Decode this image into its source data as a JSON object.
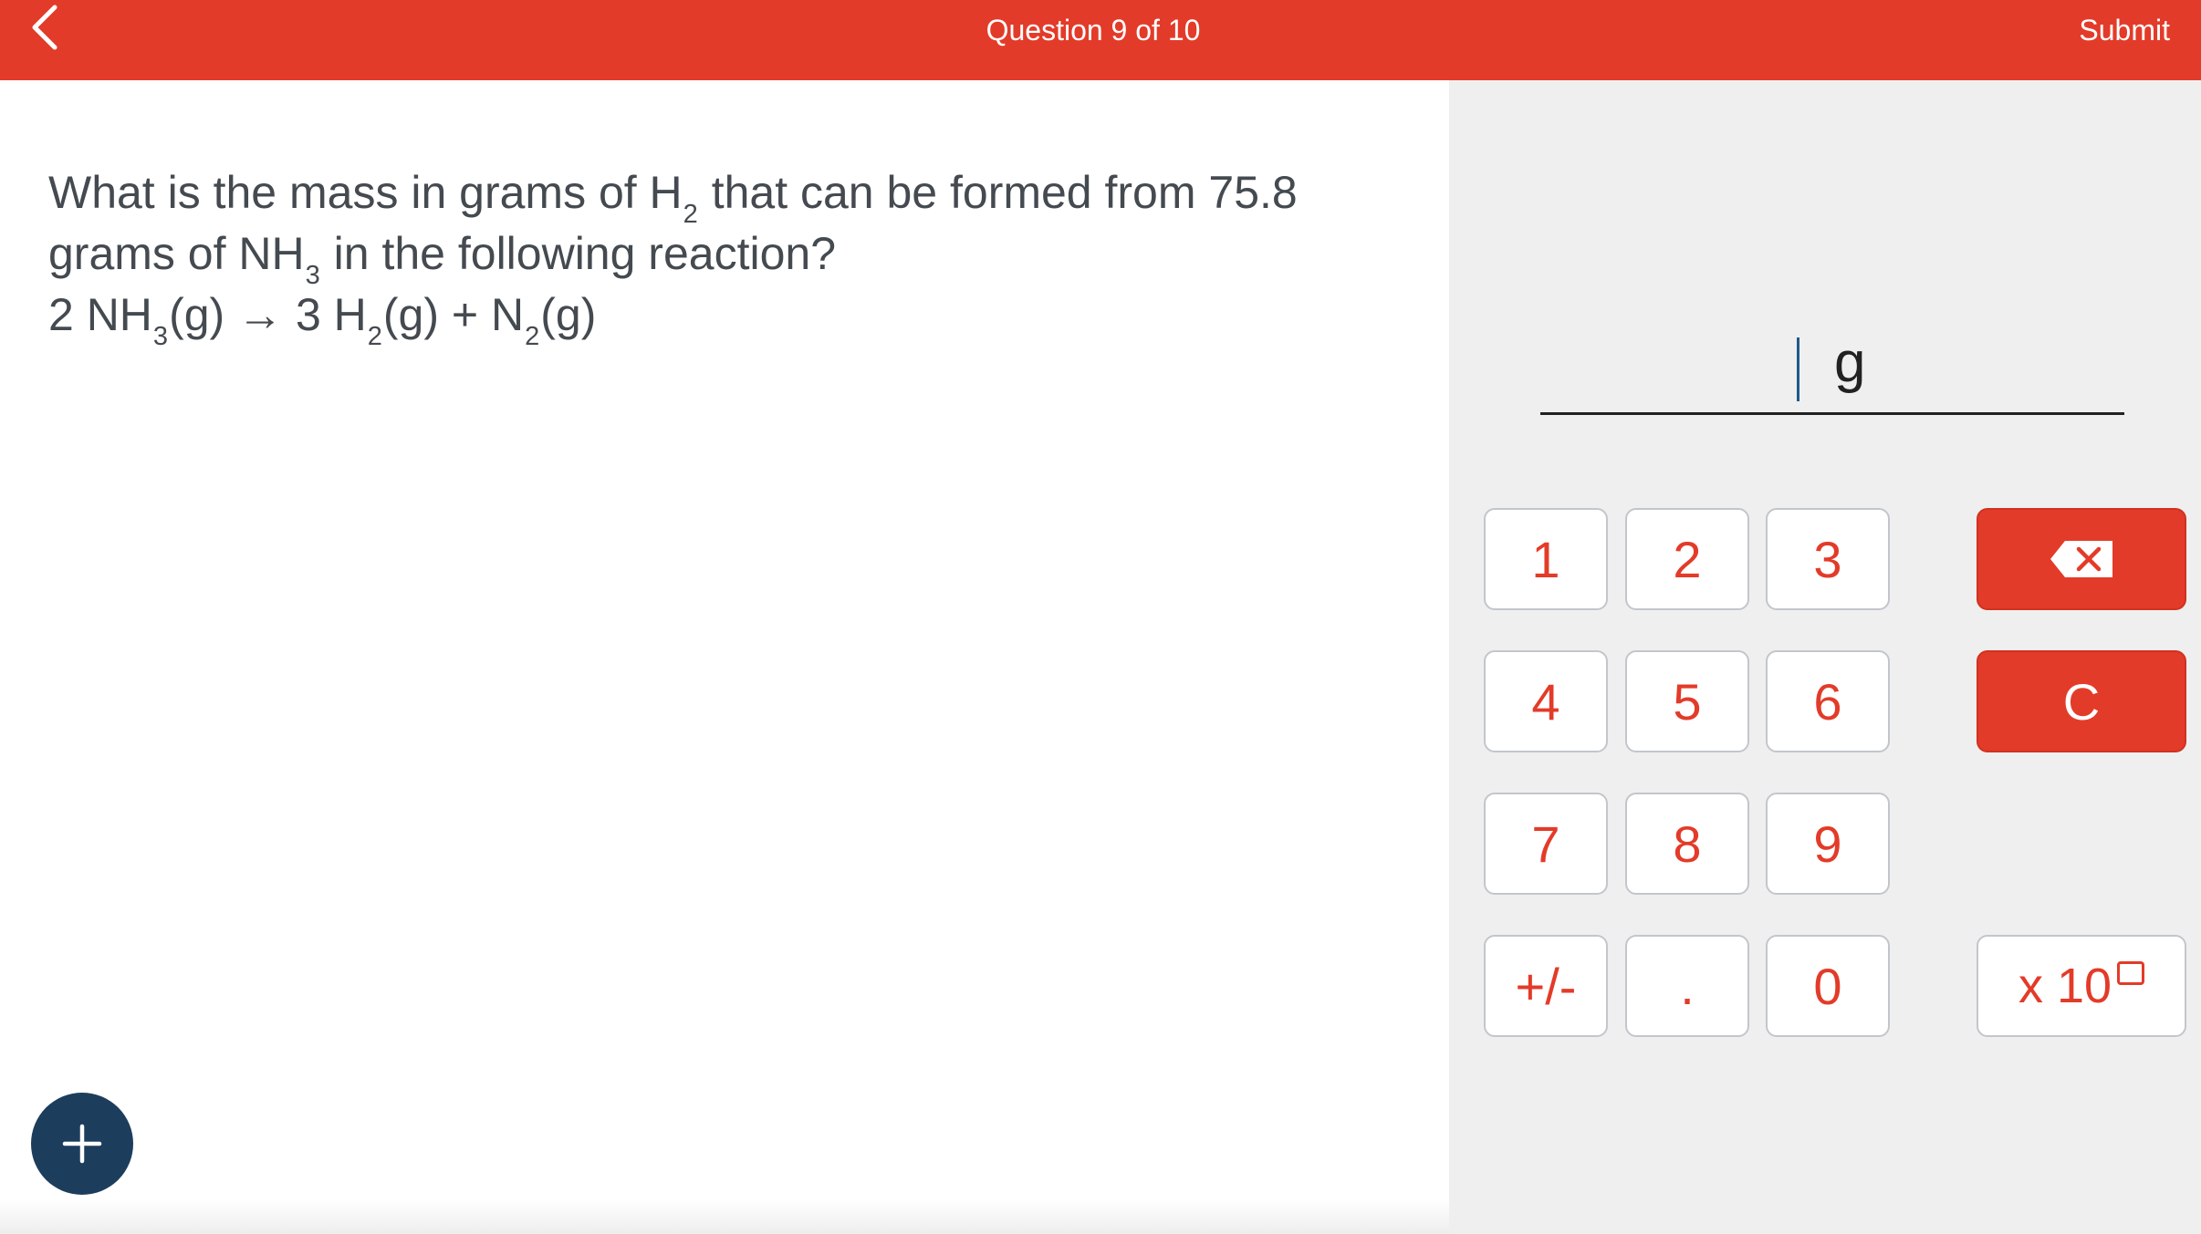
{
  "header": {
    "title": "Question 9 of 10",
    "submit_label": "Submit"
  },
  "question": {
    "line1_a": "What is the mass in grams of H",
    "line1_sub": "2",
    "line1_b": " that can be formed from 75.8",
    "line2_a": "grams of NH",
    "line2_sub": "3",
    "line2_b": " in the following reaction?",
    "eq_a": "2 NH",
    "eq_sub1": "3",
    "eq_b": "(g) → 3 H",
    "eq_sub2": "2",
    "eq_c": "(g) + N",
    "eq_sub3": "2",
    "eq_d": "(g)"
  },
  "answer": {
    "value": "",
    "unit": "g"
  },
  "keypad": {
    "k1": "1",
    "k2": "2",
    "k3": "3",
    "k4": "4",
    "k5": "5",
    "k6": "6",
    "k7": "7",
    "k8": "8",
    "k9": "9",
    "sign": "+/-",
    "dot": ".",
    "k0": "0",
    "clear": "C",
    "sci": "x 10"
  },
  "colors": {
    "accent": "#e33b29",
    "fab": "#1d3d5d",
    "panel": "#efefef"
  },
  "icons": {
    "back": "chevron-left-icon",
    "backspace": "backspace-icon",
    "add": "plus-icon"
  }
}
